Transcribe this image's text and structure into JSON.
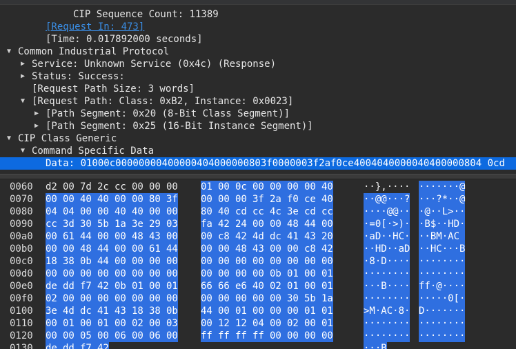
{
  "tree": [
    {
      "text": "CIP Sequence Count: 11389",
      "indent": 106,
      "arrow": "none"
    },
    {
      "text": "[Request In: 473]",
      "indent": 66,
      "arrow": "none",
      "link": true
    },
    {
      "text": "[Time: 0.017892000 seconds]",
      "indent": 66,
      "arrow": "none"
    },
    {
      "text": "Common Industrial Protocol",
      "indent": 26,
      "arrow": "down"
    },
    {
      "text": "Service: Unknown Service (0x4c) (Response)",
      "indent": 46,
      "arrow": "right"
    },
    {
      "text": "Status: Success:",
      "indent": 46,
      "arrow": "right"
    },
    {
      "text": "[Request Path Size: 3 words]",
      "indent": 46,
      "arrow": "none"
    },
    {
      "text": "[Request Path: Class: 0xB2, Instance: 0x0023]",
      "indent": 46,
      "arrow": "down"
    },
    {
      "text": "[Path Segment: 0x20 (8-Bit Class Segment)]",
      "indent": 66,
      "arrow": "right"
    },
    {
      "text": "[Path Segment: 0x25 (16-Bit Instance Segment)]",
      "indent": 66,
      "arrow": "right"
    },
    {
      "text": "CIP Class Generic",
      "indent": 26,
      "arrow": "down"
    },
    {
      "text": "Command Specific Data",
      "indent": 46,
      "arrow": "down"
    },
    {
      "text": "Data: 01000c00000000400000404000000803f0000003f2af0ce4004040000040400000804 0cd",
      "indent": 66,
      "arrow": "none",
      "selected": true
    }
  ],
  "hex": [
    {
      "offset": "0060",
      "bytes": [
        "d2",
        "00",
        "7d",
        "2c",
        "cc",
        "00",
        "00",
        "00",
        "01",
        "00",
        "0c",
        "00",
        "00",
        "00",
        "00",
        "40"
      ],
      "hl_from": 8,
      "ascii": [
        "··},····",
        "·······@"
      ]
    },
    {
      "offset": "0070",
      "bytes": [
        "00",
        "00",
        "40",
        "40",
        "00",
        "00",
        "80",
        "3f",
        "00",
        "00",
        "00",
        "3f",
        "2a",
        "f0",
        "ce",
        "40"
      ],
      "hl_from": 0,
      "ascii": [
        "··@@···?",
        "···?*··@"
      ]
    },
    {
      "offset": "0080",
      "bytes": [
        "04",
        "04",
        "00",
        "00",
        "40",
        "40",
        "00",
        "00",
        "80",
        "40",
        "cd",
        "cc",
        "4c",
        "3e",
        "cd",
        "cc"
      ],
      "hl_from": 0,
      "ascii": [
        "····@@··",
        "·@··L>··"
      ]
    },
    {
      "offset": "0090",
      "bytes": [
        "cc",
        "3d",
        "30",
        "5b",
        "1a",
        "3e",
        "29",
        "03",
        "fa",
        "42",
        "24",
        "00",
        "00",
        "48",
        "44",
        "00"
      ],
      "hl_from": 0,
      "ascii": [
        "·=0[·>)·",
        "·B$··HD·"
      ]
    },
    {
      "offset": "00a0",
      "bytes": [
        "00",
        "61",
        "44",
        "00",
        "00",
        "48",
        "43",
        "00",
        "00",
        "c8",
        "42",
        "4d",
        "dc",
        "41",
        "43",
        "20"
      ],
      "hl_from": 0,
      "ascii": [
        "·aD··HC·",
        "··BM·AC "
      ]
    },
    {
      "offset": "00b0",
      "bytes": [
        "00",
        "00",
        "48",
        "44",
        "00",
        "00",
        "61",
        "44",
        "00",
        "00",
        "48",
        "43",
        "00",
        "00",
        "c8",
        "42"
      ],
      "hl_from": 0,
      "ascii": [
        "··HD··aD",
        "··HC···B"
      ]
    },
    {
      "offset": "00c0",
      "bytes": [
        "18",
        "38",
        "0b",
        "44",
        "00",
        "00",
        "00",
        "00",
        "00",
        "00",
        "00",
        "00",
        "00",
        "00",
        "00",
        "00"
      ],
      "hl_from": 0,
      "ascii": [
        "·8·D····",
        "········"
      ]
    },
    {
      "offset": "00d0",
      "bytes": [
        "00",
        "00",
        "00",
        "00",
        "00",
        "00",
        "00",
        "00",
        "00",
        "00",
        "00",
        "00",
        "0b",
        "01",
        "00",
        "01"
      ],
      "hl_from": 0,
      "ascii": [
        "········",
        "········"
      ]
    },
    {
      "offset": "00e0",
      "bytes": [
        "de",
        "dd",
        "f7",
        "42",
        "0b",
        "01",
        "00",
        "01",
        "66",
        "66",
        "e6",
        "40",
        "02",
        "01",
        "00",
        "01"
      ],
      "hl_from": 0,
      "ascii": [
        "···B····",
        "ff·@····"
      ]
    },
    {
      "offset": "00f0",
      "bytes": [
        "02",
        "00",
        "00",
        "00",
        "00",
        "00",
        "00",
        "00",
        "00",
        "00",
        "00",
        "00",
        "00",
        "30",
        "5b",
        "1a"
      ],
      "hl_from": 0,
      "ascii": [
        "········",
        "·····0[·"
      ]
    },
    {
      "offset": "0100",
      "bytes": [
        "3e",
        "4d",
        "dc",
        "41",
        "43",
        "18",
        "38",
        "0b",
        "44",
        "00",
        "01",
        "00",
        "00",
        "00",
        "01",
        "01"
      ],
      "hl_from": 0,
      "ascii": [
        ">M·AC·8·",
        "D·······"
      ]
    },
    {
      "offset": "0110",
      "bytes": [
        "00",
        "01",
        "00",
        "01",
        "00",
        "02",
        "00",
        "03",
        "00",
        "12",
        "12",
        "04",
        "00",
        "02",
        "00",
        "01"
      ],
      "hl_from": 0,
      "ascii": [
        "········",
        "········"
      ]
    },
    {
      "offset": "0120",
      "bytes": [
        "00",
        "00",
        "05",
        "00",
        "06",
        "00",
        "06",
        "00",
        "ff",
        "ff",
        "ff",
        "ff",
        "00",
        "00",
        "00",
        "00"
      ],
      "hl_from": 0,
      "ascii": [
        "········",
        "········"
      ]
    },
    {
      "offset": "0130",
      "bytes": [
        "de",
        "dd",
        "f7",
        "42"
      ],
      "hl_from": 0,
      "ascii": [
        "···B",
        ""
      ]
    }
  ]
}
